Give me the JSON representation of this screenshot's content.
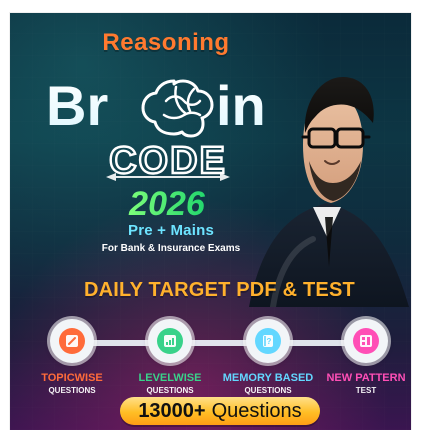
{
  "header": {
    "top_line": "Reasoning",
    "brand_line_1": "Br",
    "brand_line_1_end": "in",
    "brand_line_2": "CODE",
    "brand_year": "2026",
    "tagline": "Pre + Mains",
    "subtitle": "For Bank & Insurance Exams",
    "headline": "DAILY TARGET PDF & TEST"
  },
  "features": [
    {
      "title": "TOPICWISE",
      "subtitle": "QUESTIONS",
      "icon": "pencil-badge-icon",
      "color": "#ff6b3a"
    },
    {
      "title": "LEVELWISE",
      "subtitle": "QUESTIONS",
      "icon": "bar-chart-icon",
      "color": "#39d28a"
    },
    {
      "title": "MEMORY BASED",
      "subtitle": "QUESTIONS",
      "icon": "question-notebook-icon",
      "color": "#63d7ff"
    },
    {
      "title": "NEW PATTERN",
      "subtitle": "TEST",
      "icon": "document-grid-icon",
      "color": "#ff4fb6"
    }
  ],
  "cta": {
    "count": "13000+",
    "label": "Questions"
  },
  "colors": {
    "accent_orange": "#ff7a2f",
    "accent_yellow": "#ffb12d",
    "accent_cyan": "#6de4ff",
    "accent_green": "#39d28a",
    "accent_pink": "#ff4fb6"
  }
}
